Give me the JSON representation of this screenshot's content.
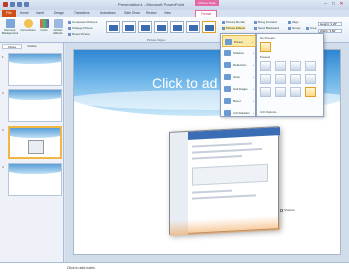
{
  "app_title": "Presentation1 - Microsoft PowerPoint",
  "context_group": "Picture Tools",
  "tabs": {
    "file": "File",
    "items": [
      "Home",
      "Insert",
      "Design",
      "Transitions",
      "Animations",
      "Slide Show",
      "Review",
      "View"
    ],
    "format": "Format"
  },
  "ribbon": {
    "remove_background": "Remove Background",
    "corrections": "Corrections",
    "color": "Color",
    "artistic_effects": "Artistic Effects",
    "compress": "Compress Pictures",
    "change": "Change Picture",
    "reset": "Reset Picture",
    "picture_styles_label": "Picture Styles",
    "picture_border": "Picture Border",
    "picture_effects": "Picture Effects",
    "picture_layout": "Picture Layout",
    "bring_forward": "Bring Forward",
    "send_backward": "Send Backward",
    "selection_pane": "Selection Pane",
    "align": "Align",
    "group": "Group",
    "rotate": "Rotate",
    "crop": "Crop",
    "height": "Height: 3.26\"",
    "width": "Width: 3.82\""
  },
  "left_pane": {
    "tab_slides": "Slides",
    "tab_outline": "Outline",
    "slide_numbers": [
      "1",
      "2",
      "3",
      "4"
    ]
  },
  "slide": {
    "title_placeholder": "Click to ad",
    "rotation_handle_label": "Shadow"
  },
  "notes": "Click to add notes",
  "effects_menu": {
    "items": [
      "Preset",
      "Shadow",
      "Reflection",
      "Glow",
      "Soft Edges",
      "Bevel",
      "3-D Rotation"
    ]
  },
  "gallery": {
    "no_preset": "No Presets",
    "presets_header": "Presets",
    "options_link": "3-D Options..."
  }
}
